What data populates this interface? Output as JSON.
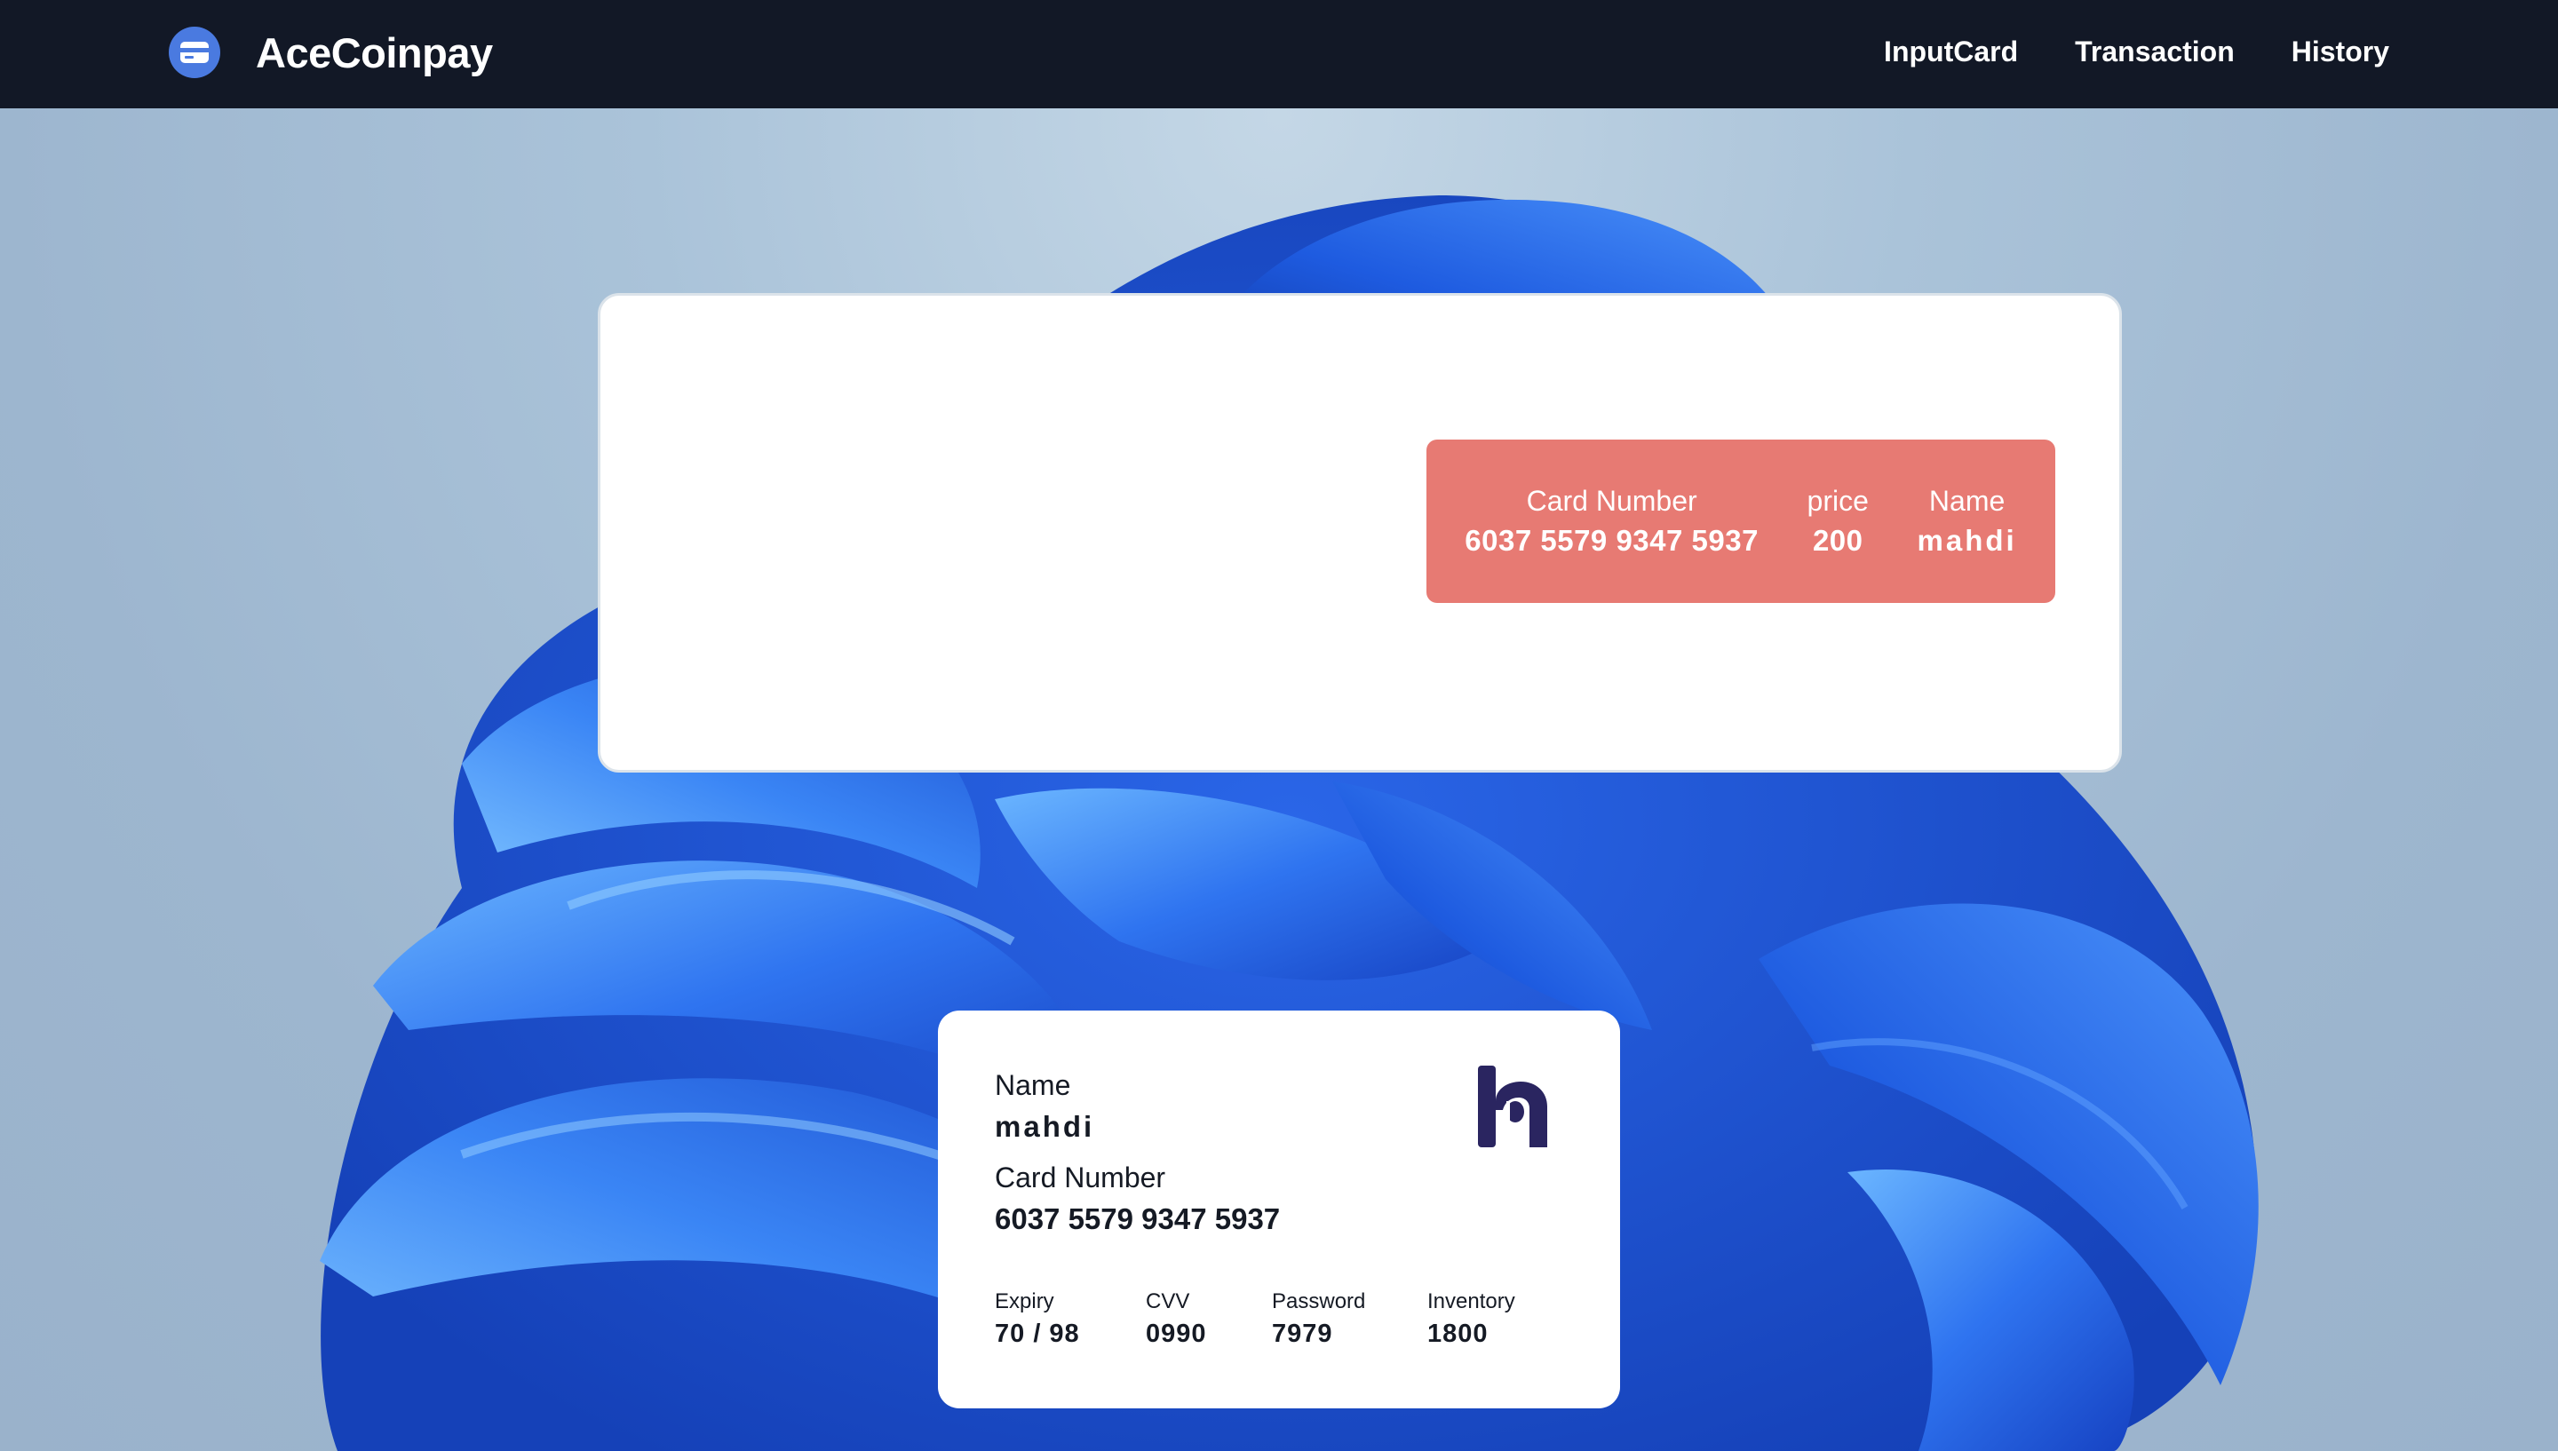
{
  "brand": {
    "name": "AceCoinpay",
    "icon": "credit-card-icon",
    "accent": "#4a7ae0"
  },
  "nav": {
    "items": [
      {
        "label": "InputCard"
      },
      {
        "label": "Transaction"
      },
      {
        "label": "History"
      }
    ]
  },
  "transaction": {
    "card_number_label": "Card Number",
    "card_number": "6037 5579 9347 5937",
    "price_label": "price",
    "price": "200",
    "name_label": "Name",
    "name": "mahdi",
    "color": "#e77a73"
  },
  "card": {
    "name_label": "Name",
    "name": "mahdi",
    "number_label": "Card Number",
    "number": "6037 5579 9347 5937",
    "expiry_label": "Expiry",
    "expiry": "70 / 98",
    "cvv_label": "CVV",
    "cvv": "0990",
    "password_label": "Password",
    "password": "7979",
    "inventory_label": "Inventory",
    "inventory": "1800",
    "logo": "bank-logo",
    "logo_color": "#2a2560"
  },
  "colors": {
    "navbar": "#121826",
    "bloom": "#2f6fe0"
  }
}
